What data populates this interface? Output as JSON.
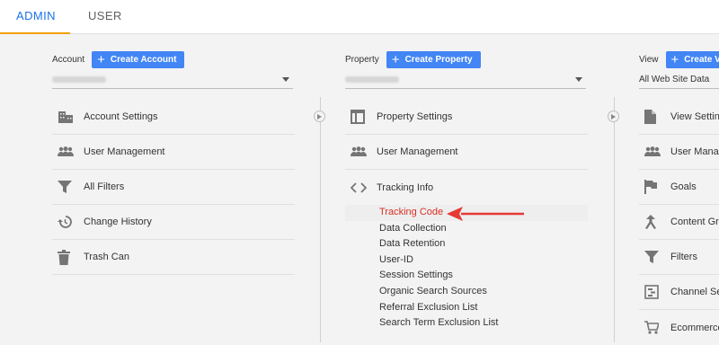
{
  "tabs": [
    {
      "label": "ADMIN",
      "active": true
    },
    {
      "label": "USER",
      "active": false
    }
  ],
  "account": {
    "label": "Account",
    "create_label": "Create Account",
    "items": [
      {
        "label": "Account Settings",
        "icon": "building-icon"
      },
      {
        "label": "User Management",
        "icon": "people-icon"
      },
      {
        "label": "All Filters",
        "icon": "filter-icon"
      },
      {
        "label": "Change History",
        "icon": "history-icon"
      },
      {
        "label": "Trash Can",
        "icon": "trash-icon"
      }
    ]
  },
  "property": {
    "label": "Property",
    "create_label": "Create Property",
    "items": [
      {
        "label": "Property Settings",
        "icon": "window-icon"
      },
      {
        "label": "User Management",
        "icon": "people-icon"
      },
      {
        "label": "Tracking Info",
        "icon": "code-icon"
      }
    ],
    "tracking_subitems": [
      "Tracking Code",
      "Data Collection",
      "Data Retention",
      "User-ID",
      "Session Settings",
      "Organic Search Sources",
      "Referral Exclusion List",
      "Search Term Exclusion List"
    ]
  },
  "view": {
    "label": "View",
    "create_label": "Create Vi",
    "selected": "All Web Site Data",
    "items": [
      {
        "label": "View Settin",
        "icon": "document-icon"
      },
      {
        "label": "User Mana",
        "icon": "people-icon"
      },
      {
        "label": "Goals",
        "icon": "flag-icon"
      },
      {
        "label": "Content Gr",
        "icon": "content-grouping-icon"
      },
      {
        "label": "Filters",
        "icon": "filter-icon"
      },
      {
        "label": "Channel Se",
        "icon": "channel-settings-icon"
      },
      {
        "label": "Ecommerce",
        "icon": "cart-icon"
      }
    ]
  },
  "colors": {
    "accent": "#4285f4",
    "tab_active": "#1a73e8",
    "tab_underline": "#f4a000",
    "highlight": "#d93025",
    "arrow": "#e53935"
  }
}
